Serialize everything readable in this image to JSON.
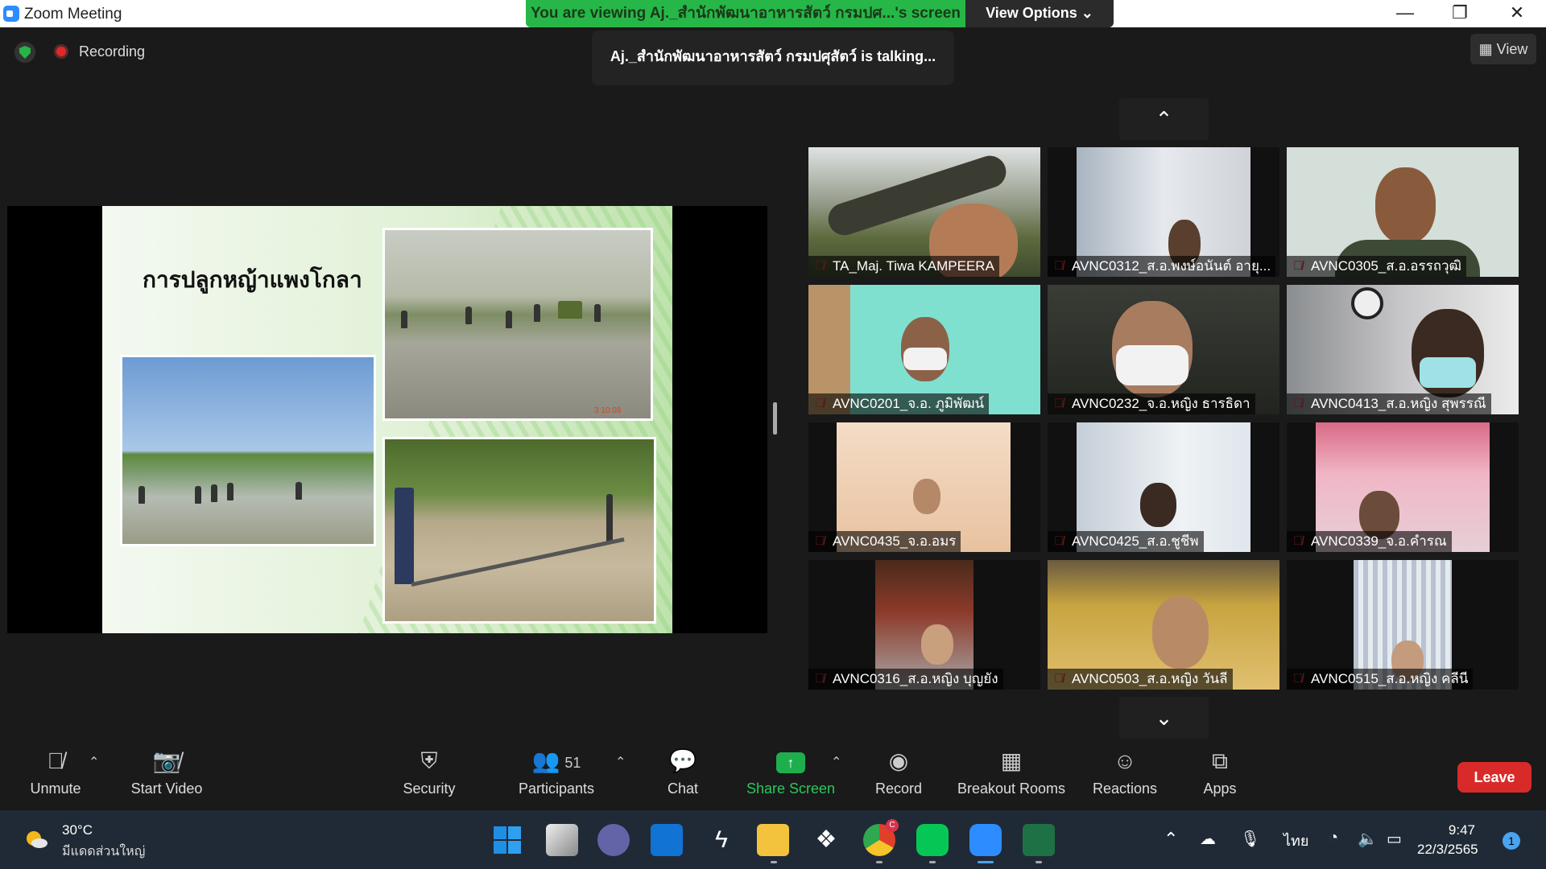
{
  "window": {
    "title": "Zoom Meeting",
    "banner": "You are viewing Aj._สำนักพัฒนาอาหารสัตว์ กรมปศ...'s screen",
    "view_options": "View Options ⌄",
    "controls": [
      "—",
      "❐",
      "✕"
    ]
  },
  "top": {
    "recording_label": "Recording",
    "talking": "Aj._สำนักพัฒนาอาหารสัตว์ กรมปศุสัตว์ is talking...",
    "view_label": "View"
  },
  "slide": {
    "title": "การปลูกหญ้าแพงโกลา",
    "stamp": "3 10:08"
  },
  "gallery": {
    "up_arrow": "⌃",
    "down_arrow": "⌄",
    "participants": [
      {
        "name": "TA_Maj. Tiwa KAMPEERA",
        "bg": "#6e7058"
      },
      {
        "name": "AVNC0312_ส.อ.พงษ์อนันต์ อายุ...",
        "bg": "#c9ccd2"
      },
      {
        "name": "AVNC0305_ส.อ.อรรถวุฒิ",
        "bg": "#d5dfd9"
      },
      {
        "name": "AVNC0201_จ.อ. ภูมิพัฒน์",
        "bg": "#7fe0d0"
      },
      {
        "name": "AVNC0232_จ.อ.หญิง ธารธิดา",
        "bg": "#3a3c36"
      },
      {
        "name": "AVNC0413_ส.อ.หญิง สุพรรณี",
        "bg": "#c7c6c8"
      },
      {
        "name": "AVNC0435_จ.อ.อมร",
        "bg": "#f0d7c2"
      },
      {
        "name": "AVNC0425_ส.อ.ชูชีพ",
        "bg": "#dfe6ec"
      },
      {
        "name": "AVNC0339_จ.อ.คำรณ",
        "bg": "#d96a86"
      },
      {
        "name": "AVNC0316_ส.อ.หญิง บุญยัง",
        "bg": "#6b3f2a"
      },
      {
        "name": "AVNC0503_ส.อ.หญิง วันลี",
        "bg": "#c8a440"
      },
      {
        "name": "AVNC0515_ส.อ.หญิง คลีนี",
        "bg": "#b8c2d0"
      }
    ]
  },
  "toolbar": {
    "unmute": "Unmute",
    "start_video": "Start Video",
    "security": "Security",
    "participants": "Participants",
    "participants_count": "51",
    "chat": "Chat",
    "share_screen": "Share Screen",
    "record": "Record",
    "breakout_rooms": "Breakout Rooms",
    "reactions": "Reactions",
    "apps": "Apps",
    "leave": "Leave"
  },
  "taskbar": {
    "temperature": "30°C",
    "weather": "มีแดดส่วนใหญ่",
    "language": "ไทย",
    "time": "9:47",
    "date": "22/3/2565",
    "notifications": "1",
    "chrome_badge": "C"
  }
}
